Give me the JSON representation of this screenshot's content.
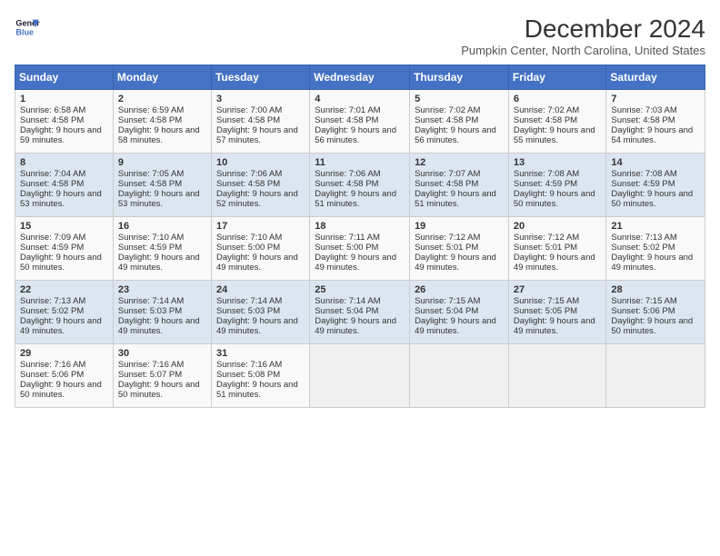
{
  "logo": {
    "line1": "General",
    "line2": "Blue"
  },
  "title": "December 2024",
  "subtitle": "Pumpkin Center, North Carolina, United States",
  "days_header": [
    "Sunday",
    "Monday",
    "Tuesday",
    "Wednesday",
    "Thursday",
    "Friday",
    "Saturday"
  ],
  "weeks": [
    [
      {
        "day": "1",
        "sunrise": "6:58 AM",
        "sunset": "4:58 PM",
        "daylight": "9 hours and 59 minutes."
      },
      {
        "day": "2",
        "sunrise": "6:59 AM",
        "sunset": "4:58 PM",
        "daylight": "9 hours and 58 minutes."
      },
      {
        "day": "3",
        "sunrise": "7:00 AM",
        "sunset": "4:58 PM",
        "daylight": "9 hours and 57 minutes."
      },
      {
        "day": "4",
        "sunrise": "7:01 AM",
        "sunset": "4:58 PM",
        "daylight": "9 hours and 56 minutes."
      },
      {
        "day": "5",
        "sunrise": "7:02 AM",
        "sunset": "4:58 PM",
        "daylight": "9 hours and 56 minutes."
      },
      {
        "day": "6",
        "sunrise": "7:02 AM",
        "sunset": "4:58 PM",
        "daylight": "9 hours and 55 minutes."
      },
      {
        "day": "7",
        "sunrise": "7:03 AM",
        "sunset": "4:58 PM",
        "daylight": "9 hours and 54 minutes."
      }
    ],
    [
      {
        "day": "8",
        "sunrise": "7:04 AM",
        "sunset": "4:58 PM",
        "daylight": "9 hours and 53 minutes."
      },
      {
        "day": "9",
        "sunrise": "7:05 AM",
        "sunset": "4:58 PM",
        "daylight": "9 hours and 53 minutes."
      },
      {
        "day": "10",
        "sunrise": "7:06 AM",
        "sunset": "4:58 PM",
        "daylight": "9 hours and 52 minutes."
      },
      {
        "day": "11",
        "sunrise": "7:06 AM",
        "sunset": "4:58 PM",
        "daylight": "9 hours and 51 minutes."
      },
      {
        "day": "12",
        "sunrise": "7:07 AM",
        "sunset": "4:58 PM",
        "daylight": "9 hours and 51 minutes."
      },
      {
        "day": "13",
        "sunrise": "7:08 AM",
        "sunset": "4:59 PM",
        "daylight": "9 hours and 50 minutes."
      },
      {
        "day": "14",
        "sunrise": "7:08 AM",
        "sunset": "4:59 PM",
        "daylight": "9 hours and 50 minutes."
      }
    ],
    [
      {
        "day": "15",
        "sunrise": "7:09 AM",
        "sunset": "4:59 PM",
        "daylight": "9 hours and 50 minutes."
      },
      {
        "day": "16",
        "sunrise": "7:10 AM",
        "sunset": "4:59 PM",
        "daylight": "9 hours and 49 minutes."
      },
      {
        "day": "17",
        "sunrise": "7:10 AM",
        "sunset": "5:00 PM",
        "daylight": "9 hours and 49 minutes."
      },
      {
        "day": "18",
        "sunrise": "7:11 AM",
        "sunset": "5:00 PM",
        "daylight": "9 hours and 49 minutes."
      },
      {
        "day": "19",
        "sunrise": "7:12 AM",
        "sunset": "5:01 PM",
        "daylight": "9 hours and 49 minutes."
      },
      {
        "day": "20",
        "sunrise": "7:12 AM",
        "sunset": "5:01 PM",
        "daylight": "9 hours and 49 minutes."
      },
      {
        "day": "21",
        "sunrise": "7:13 AM",
        "sunset": "5:02 PM",
        "daylight": "9 hours and 49 minutes."
      }
    ],
    [
      {
        "day": "22",
        "sunrise": "7:13 AM",
        "sunset": "5:02 PM",
        "daylight": "9 hours and 49 minutes."
      },
      {
        "day": "23",
        "sunrise": "7:14 AM",
        "sunset": "5:03 PM",
        "daylight": "9 hours and 49 minutes."
      },
      {
        "day": "24",
        "sunrise": "7:14 AM",
        "sunset": "5:03 PM",
        "daylight": "9 hours and 49 minutes."
      },
      {
        "day": "25",
        "sunrise": "7:14 AM",
        "sunset": "5:04 PM",
        "daylight": "9 hours and 49 minutes."
      },
      {
        "day": "26",
        "sunrise": "7:15 AM",
        "sunset": "5:04 PM",
        "daylight": "9 hours and 49 minutes."
      },
      {
        "day": "27",
        "sunrise": "7:15 AM",
        "sunset": "5:05 PM",
        "daylight": "9 hours and 49 minutes."
      },
      {
        "day": "28",
        "sunrise": "7:15 AM",
        "sunset": "5:06 PM",
        "daylight": "9 hours and 50 minutes."
      }
    ],
    [
      {
        "day": "29",
        "sunrise": "7:16 AM",
        "sunset": "5:06 PM",
        "daylight": "9 hours and 50 minutes."
      },
      {
        "day": "30",
        "sunrise": "7:16 AM",
        "sunset": "5:07 PM",
        "daylight": "9 hours and 50 minutes."
      },
      {
        "day": "31",
        "sunrise": "7:16 AM",
        "sunset": "5:08 PM",
        "daylight": "9 hours and 51 minutes."
      },
      null,
      null,
      null,
      null
    ]
  ]
}
